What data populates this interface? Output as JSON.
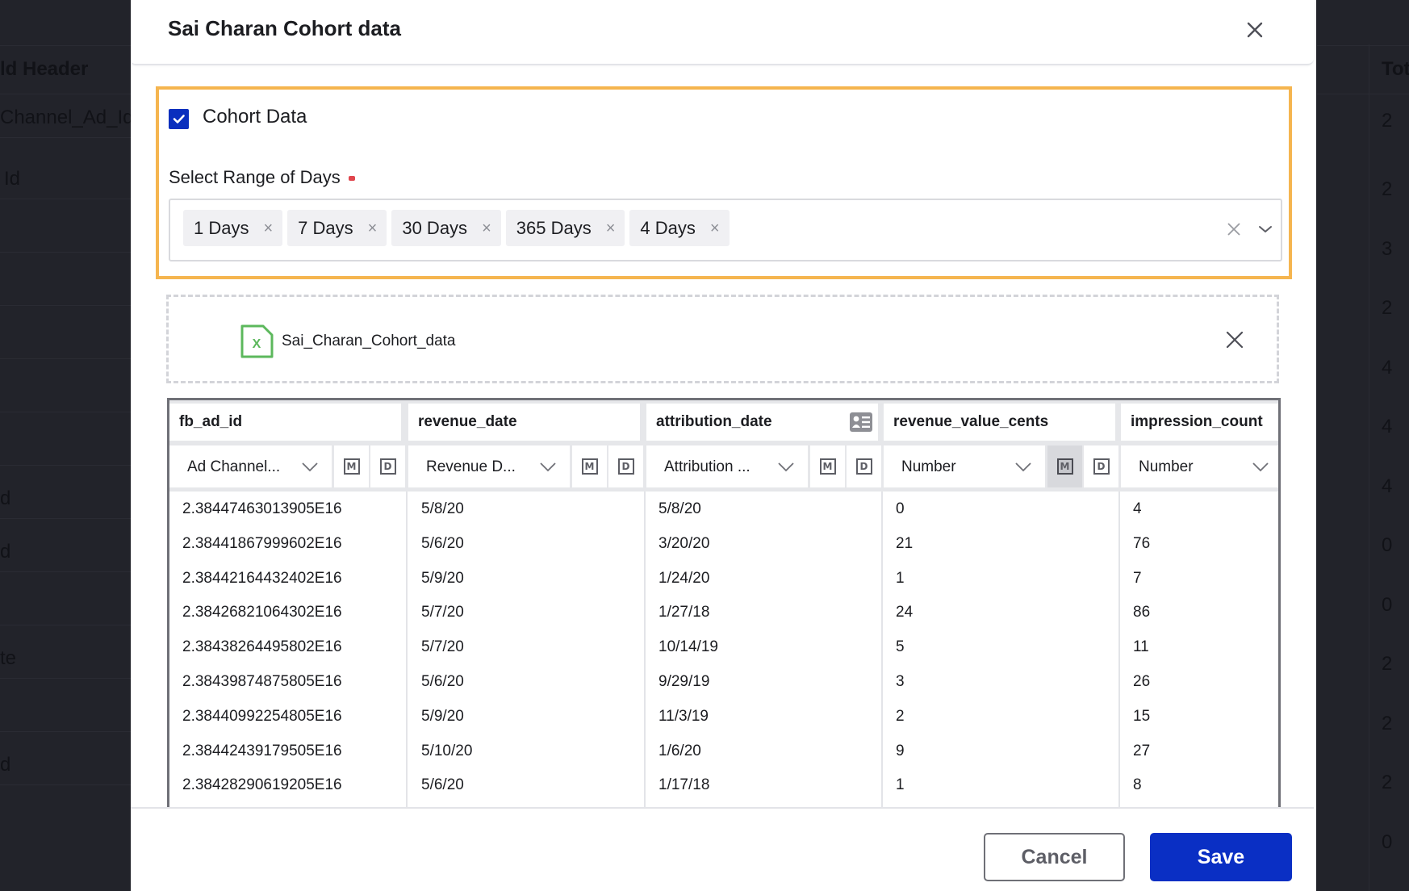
{
  "background": {
    "left_column": {
      "header": "ld Header",
      "cells": [
        "Channel_Ad_Id.",
        "Id",
        "",
        "",
        "",
        "",
        "",
        "d",
        "d",
        "",
        "te",
        "",
        "d"
      ]
    },
    "right_column": {
      "header": "Tota",
      "cells": [
        "2",
        "2",
        "3",
        "2",
        "4",
        "4",
        "4",
        "0",
        "0",
        "2",
        "2",
        "2",
        "0"
      ]
    }
  },
  "modal": {
    "title": "Sai Charan Cohort data",
    "close_icon": "close-icon",
    "cohort": {
      "checkbox_checked": true,
      "checkbox_label": "Cohort Data",
      "range_label": "Select Range of Days",
      "required": true,
      "selected_days": [
        {
          "label": "1 Days"
        },
        {
          "label": "7 Days"
        },
        {
          "label": "30 Days"
        },
        {
          "label": "365 Days"
        },
        {
          "label": "4 Days"
        }
      ],
      "chip_remove_glyph": "×"
    },
    "upload": {
      "file_icon": "excel-file-icon",
      "file_icon_letter": "X",
      "file_name": "Sai_Charan_Cohort_data"
    },
    "table": {
      "columns": [
        {
          "name": "fb_ad_id",
          "type": "Ad Channel...",
          "has_md": true,
          "m_active": false
        },
        {
          "name": "revenue_date",
          "type": "Revenue D...",
          "has_md": true,
          "m_active": false
        },
        {
          "name": "attribution_date",
          "type": "Attribution ...",
          "has_md": true,
          "m_active": false,
          "header_icon": "id-card-icon"
        },
        {
          "name": "revenue_value_cents",
          "type": "Number",
          "has_md": true,
          "m_active": true
        },
        {
          "name": "impression_count",
          "type": "Number",
          "has_md": false,
          "m_active": false
        }
      ],
      "md_labels": {
        "m": "M",
        "d": "D"
      },
      "rows": [
        [
          "2.38447463013905E16",
          "5/8/20",
          "5/8/20",
          "0",
          "4"
        ],
        [
          "2.38441867999602E16",
          "5/6/20",
          "3/20/20",
          "21",
          "76"
        ],
        [
          "2.38442164432402E16",
          "5/9/20",
          "1/24/20",
          "1",
          "7"
        ],
        [
          "2.38426821064302E16",
          "5/7/20",
          "1/27/18",
          "24",
          "86"
        ],
        [
          "2.38438264495802E16",
          "5/7/20",
          "10/14/19",
          "5",
          "11"
        ],
        [
          "2.38439874875805E16",
          "5/6/20",
          "9/29/19",
          "3",
          "26"
        ],
        [
          "2.38440992254805E16",
          "5/9/20",
          "11/3/19",
          "2",
          "15"
        ],
        [
          "2.38442439179505E16",
          "5/10/20",
          "1/6/20",
          "9",
          "27"
        ],
        [
          "2.38428290619205E16",
          "5/6/20",
          "1/17/18",
          "1",
          "8"
        ]
      ]
    },
    "footer": {
      "cancel_label": "Cancel",
      "save_label": "Save"
    }
  },
  "colors": {
    "highlight_border": "#f5b54f",
    "primary": "#0a2fc4",
    "required": "#e0464d",
    "file_icon": "#5cb85c"
  }
}
